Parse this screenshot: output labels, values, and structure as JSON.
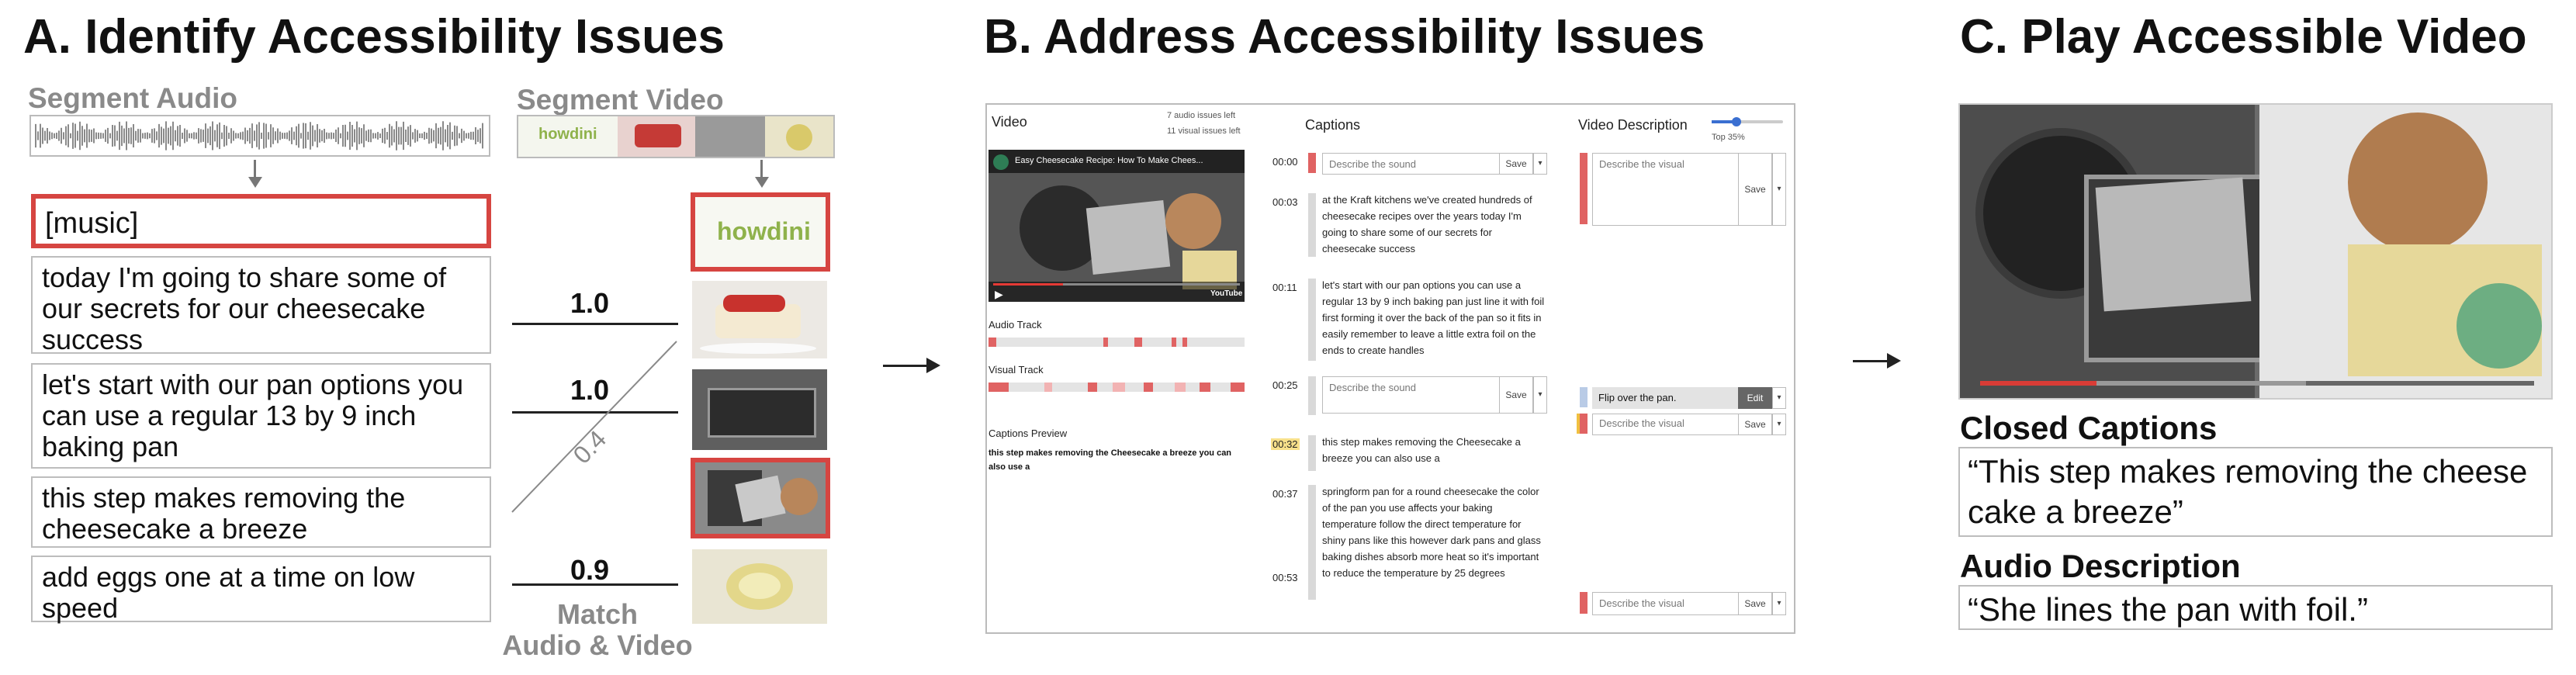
{
  "panel_a": {
    "title": "A. Identify Accessibility Issues",
    "segment_audio": "Segment Audio",
    "segment_video": "Segment Video",
    "segments": [
      "[music]",
      "today I'm going to share some of our secrets for our cheesecake success",
      "let's start with our pan options you can use a regular 13 by 9 inch baking pan",
      "this step makes removing the cheesecake a breeze",
      "add eggs one at a time on low speed"
    ],
    "logo_text": "howdini",
    "scores": [
      "1.0",
      "1.0",
      "0.4",
      "0.9"
    ],
    "match_label": "Match\nAudio & Video"
  },
  "panel_b": {
    "title": "B. Address Accessibility Issues",
    "video_label": "Video",
    "audio_issues": "7 audio issues left",
    "visual_issues": "11 visual issues left",
    "video_title": "Easy Cheesecake Recipe: How To Make Chees...",
    "audio_track": "Audio Track",
    "visual_track": "Visual Track",
    "captions_preview_label": "Captions Preview",
    "captions_preview_text": "this step makes removing the Cheesecake a breeze you can also use a",
    "captions_header": "Captions",
    "video_description_header": "Video Description",
    "slider_label": "Top 35%",
    "placeholder_sound": "Describe the sound",
    "placeholder_visual": "Describe the visual",
    "save": "Save",
    "edit": "Edit",
    "flip_text": "Flip over the pan.",
    "captions": [
      {
        "time": "00:00",
        "text": ""
      },
      {
        "time": "00:03",
        "text": "at the Kraft kitchens we've created hundreds of cheesecake recipes over the years today I'm going to share some of our secrets for cheesecake success"
      },
      {
        "time": "00:11",
        "text": "let's start with our pan options you can use a regular 13 by 9 inch baking pan just line it with foil first forming it over the back of the pan so it fits in easily remember to leave a little extra foil on the ends to create handles"
      },
      {
        "time": "00:25",
        "text": ""
      },
      {
        "time": "00:32",
        "text": "this step makes removing the Cheesecake a breeze you can also use a"
      },
      {
        "time": "00:37",
        "text": "springform pan for a round cheesecake the color of the pan you use affects your baking temperature follow the direct temperature for shiny pans like this however dark pans and glass baking dishes absorb more heat so it's important to reduce the temperature by 25 degrees"
      },
      {
        "time": "00:53",
        "text": ""
      }
    ]
  },
  "panel_c": {
    "title": "C. Play Accessible Video",
    "closed_captions_label": "Closed Captions",
    "closed_captions_text": "“This step makes removing the cheese cake a breeze”",
    "audio_description_label": "Audio Description",
    "audio_description_text": "“She lines the pan with foil.”"
  },
  "colors": {
    "red": "#d64541",
    "gray_text": "#8a8a8a",
    "highlight": "#f7e08a"
  }
}
